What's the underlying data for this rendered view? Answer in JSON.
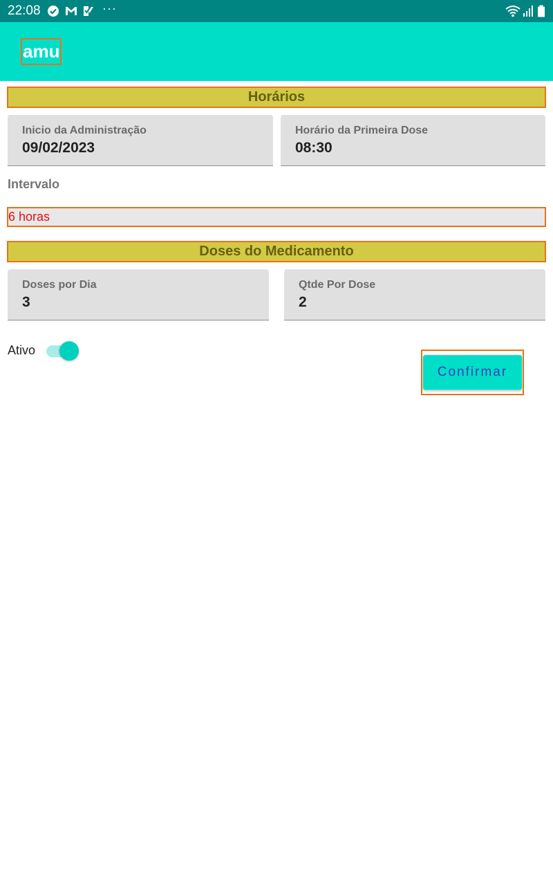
{
  "status_bar": {
    "time": "22:08",
    "left_icons": [
      "check-circle-icon",
      "gmail-icon",
      "app-notification-icon",
      "more-dots-icon"
    ],
    "right_icons": [
      "wifi-icon",
      "signal-icon",
      "battery-icon"
    ],
    "dots": "···"
  },
  "app_bar": {
    "title": "amu",
    "color": "#00dec8"
  },
  "sections": {
    "schedule_title": "Horários",
    "doses_title": "Doses do Medicamento"
  },
  "fields": {
    "start_date": {
      "label": "Inicio da Administração",
      "value": "09/02/2023"
    },
    "first_dose_time": {
      "label": "Horário da Primeira Dose",
      "value": "08:30"
    },
    "doses_per_day": {
      "label": "Doses por Dia",
      "value": "3"
    },
    "qty_per_dose": {
      "label": "Qtde Por Dose",
      "value": "2"
    }
  },
  "interval": {
    "label": "Intervalo",
    "value": "6 horas"
  },
  "active": {
    "label": "Ativo",
    "on": true
  },
  "confirm_button": {
    "label": "Confirmar"
  },
  "colors": {
    "accent": "#00dec8",
    "status_bar": "#008582",
    "section_header": "#d4c944",
    "highlight_outline": "#e8731a",
    "interval_text": "#e01010"
  }
}
